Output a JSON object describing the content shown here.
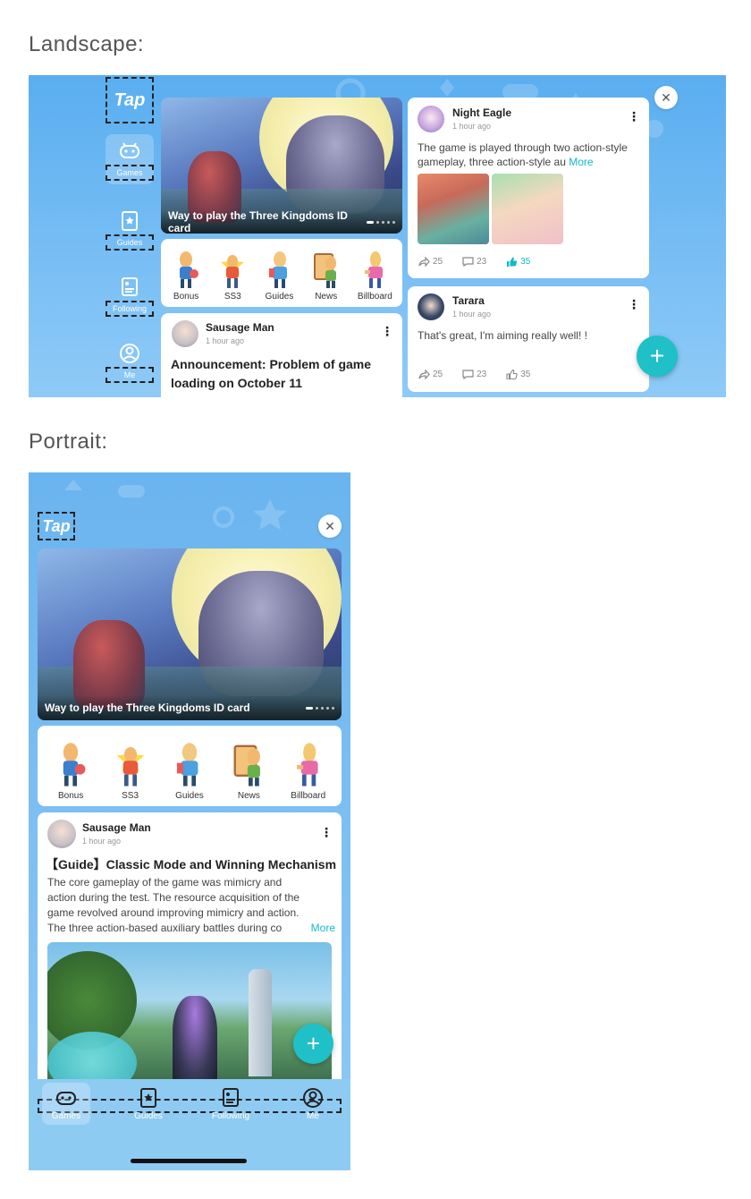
{
  "sections": {
    "landscape": "Landscape:",
    "portrait": "Portrait:"
  },
  "app": {
    "logo": "Tap"
  },
  "nav": [
    {
      "label": "Games",
      "icon": "gamepad-icon"
    },
    {
      "label": "Guides",
      "icon": "star-book-icon"
    },
    {
      "label": "Following",
      "icon": "feed-icon"
    },
    {
      "label": "Me",
      "icon": "user-icon"
    }
  ],
  "banner": {
    "caption": "Way to play the Three Kingdoms ID card",
    "slides": 5,
    "active_slide": 1
  },
  "shortcuts": [
    "Bonus",
    "SS3",
    "Guides",
    "News",
    "Billboard"
  ],
  "posts_landscape": {
    "left": {
      "author": "Sausage Man",
      "time": "1 hour ago",
      "title": "Announcement: Problem of game loading on October 11"
    },
    "right": [
      {
        "author": "Night Eagle",
        "time": "1 hour ago",
        "body": "The game is played through two action-style gameplay, three action-style au",
        "more": "More",
        "shares": "25",
        "comments": "23",
        "likes": "35",
        "liked": true
      },
      {
        "author": "Tarara",
        "time": "1 hour ago",
        "body": "That's great, I'm aiming really well! !",
        "shares": "25",
        "comments": "23",
        "likes": "35",
        "liked": false
      }
    ]
  },
  "post_portrait": {
    "author": "Sausage Man",
    "time": "1 hour ago",
    "title": "【Guide】Classic Mode and Winning Mechanism",
    "body_lines": [
      "The core gameplay of the game was mimicry and",
      "action during the test. The resource acquisition of the",
      "game revolved around improving mimicry and action.",
      "The three action-based auxiliary battles during co"
    ],
    "more": "More"
  },
  "buttons": {
    "close": "✕",
    "fab": "+"
  },
  "colors": {
    "accent": "#14b9c8",
    "fab": "#1fc0c8",
    "sky": "#6ab4ef"
  }
}
